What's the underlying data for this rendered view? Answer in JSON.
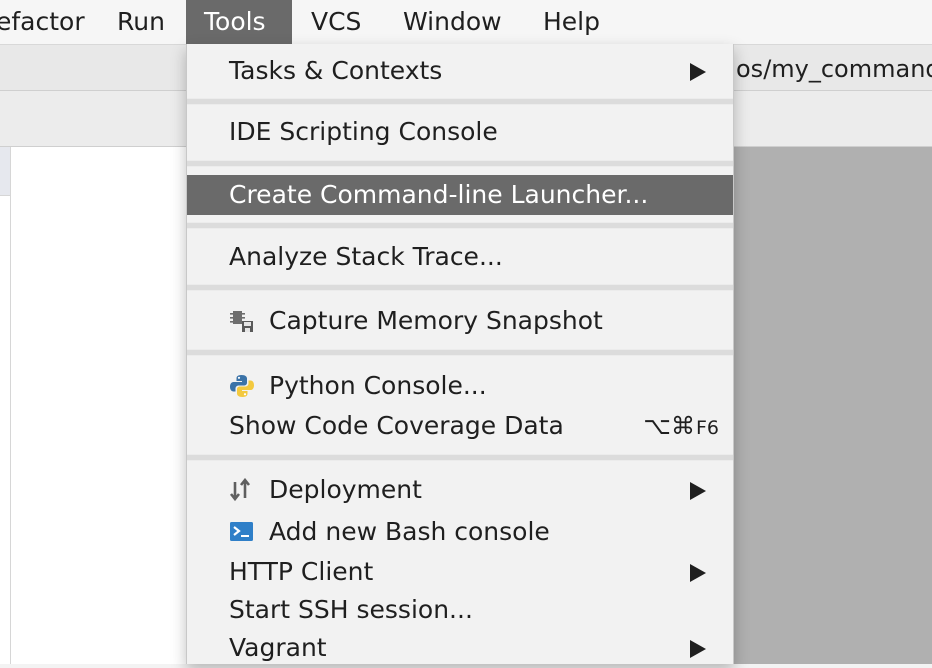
{
  "menubar": {
    "items": [
      {
        "label": "efactor"
      },
      {
        "label": "Run"
      },
      {
        "label": "Tools",
        "active": true
      },
      {
        "label": "VCS"
      },
      {
        "label": "Window"
      },
      {
        "label": "Help"
      }
    ]
  },
  "navbar": {
    "path": "os/my_command_"
  },
  "tools_menu": {
    "items": [
      {
        "label": "Tasks & Contexts",
        "submenu": true
      },
      {
        "label": "IDE Scripting Console"
      },
      {
        "label": "Create Command-line Launcher...",
        "highlighted": true
      },
      {
        "label": "Analyze Stack Trace..."
      },
      {
        "label": "Capture Memory Snapshot",
        "icon": "memory-snapshot-icon"
      },
      {
        "label": "Python Console...",
        "icon": "python-icon"
      },
      {
        "label": "Show Code Coverage Data",
        "shortcut_symbols": "⌥⌘",
        "shortcut_key": "F6"
      },
      {
        "label": "Deployment",
        "icon": "deployment-icon",
        "submenu": true
      },
      {
        "label": "Add new Bash console",
        "icon": "bash-console-icon"
      },
      {
        "label": "HTTP Client",
        "submenu": true
      },
      {
        "label": "Start SSH session..."
      },
      {
        "label": "Vagrant",
        "submenu": true
      }
    ]
  },
  "colors": {
    "highlight": "#6a6a6a",
    "menu_background": "#f2f2f2",
    "python_blue": "#3b73a8",
    "python_yellow": "#f3c93f",
    "bash_blue": "#2f7fc8"
  }
}
